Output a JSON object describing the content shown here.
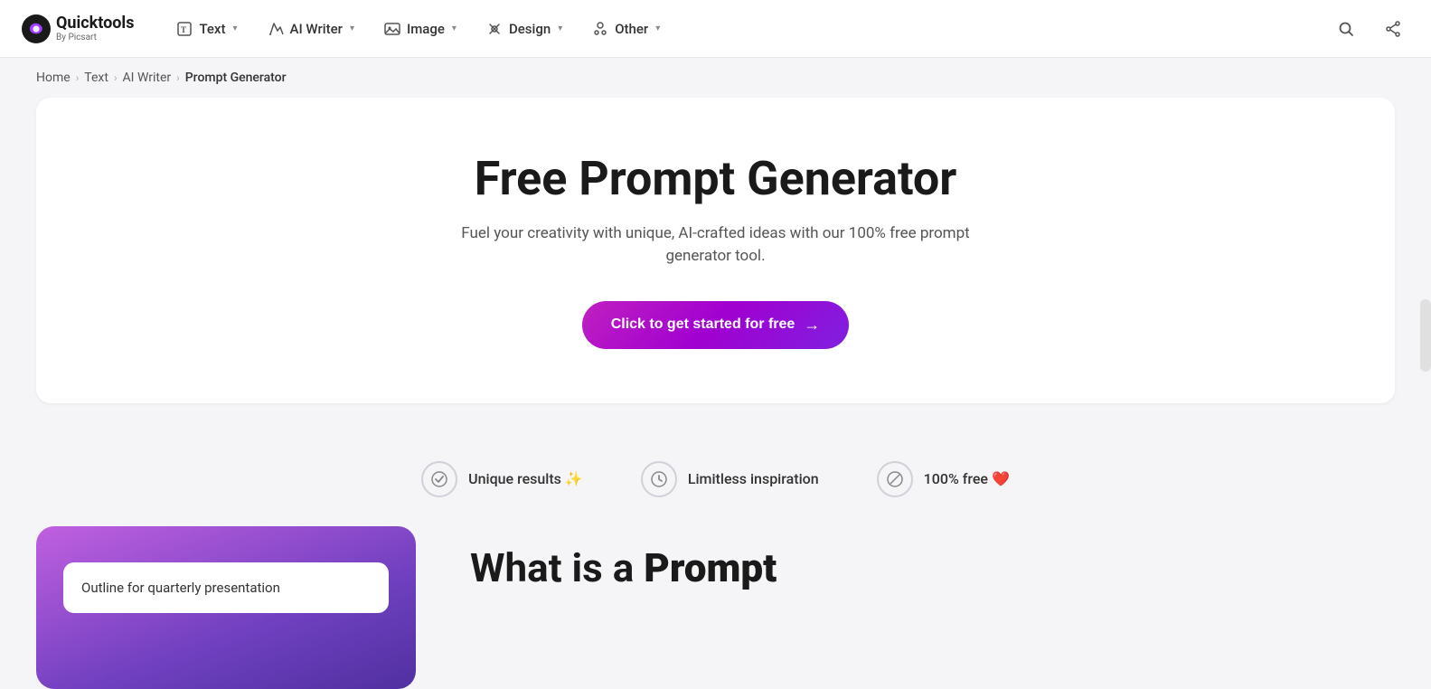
{
  "logo": {
    "main": "Quicktools",
    "sub": "By Picsart"
  },
  "navbar": {
    "items": [
      {
        "id": "text",
        "label": "Text",
        "icon": "T"
      },
      {
        "id": "ai-writer",
        "label": "AI Writer",
        "icon": "✦"
      },
      {
        "id": "image",
        "label": "Image",
        "icon": "🖼"
      },
      {
        "id": "design",
        "label": "Design",
        "icon": "✂"
      },
      {
        "id": "other",
        "label": "Other",
        "icon": "👤"
      }
    ],
    "search_aria": "Search",
    "share_aria": "Share"
  },
  "breadcrumb": {
    "items": [
      "Home",
      "Text",
      "AI Writer",
      "Prompt Generator"
    ]
  },
  "hero": {
    "title": "Free Prompt Generator",
    "subtitle": "Fuel your creativity with unique, AI-crafted ideas with our 100% free prompt generator tool.",
    "cta_label": "Click to get started for free",
    "cta_arrow": "→"
  },
  "features": [
    {
      "id": "unique",
      "icon": "✓",
      "label": "Unique results",
      "emoji": "✨"
    },
    {
      "id": "limitless",
      "icon": "⏱",
      "label": "Limitless inspiration",
      "emoji": ""
    },
    {
      "id": "free",
      "icon": "⊘",
      "label": "100% free",
      "emoji": "❤️"
    }
  ],
  "demo": {
    "input_value": "Outline for quarterly presentation"
  },
  "what_is": {
    "prefix": "What is a ",
    "bold": "Prompt"
  }
}
